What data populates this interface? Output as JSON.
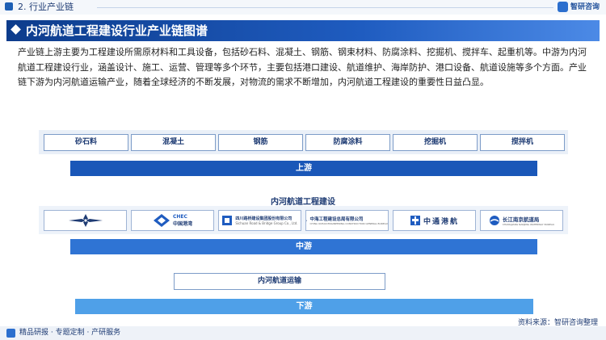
{
  "header": {
    "section_label": "2. 行业产业链",
    "brand": "智研咨询"
  },
  "title": "内河航道工程建设行业产业链图谱",
  "intro": "产业链上游主要为工程建设所需原材料和工具设备，包括砂石料、混凝土、钢筋、钢束材料、防腐涂料、挖掘机、搅拌车、起重机等。中游为内河航道工程建设行业，涵盖设计、施工、运营、管理等多个环节，主要包括港口建设、航道维护、海岸防护、港口设备、航道设施等多个方面。产业链下游为内河航道运输产业，随着全球经济的不断发展，对物流的需求不断增加，内河航道工程建设的重要性日益凸显。",
  "upstream": {
    "items": [
      "砂石料",
      "混凝土",
      "钢筋",
      "防腐涂料",
      "挖掘机",
      "搅拌机"
    ],
    "label": "上游"
  },
  "midstream": {
    "heading": "内河航道工程建设",
    "companies": [
      {
        "name": "",
        "sub": "",
        "icon": "compass-star-logo-icon"
      },
      {
        "name": "中国港湾",
        "sub": "CHEC",
        "icon": "chec-logo-icon"
      },
      {
        "name": "四川路桥建设集团股份有限公司",
        "sub": "Sichuan Road & Bridge Group Co., Ltd.",
        "icon": "srbg-logo-icon"
      },
      {
        "name": "中海工程建设总局有限公司",
        "sub": "CHINA OCEAN ENGINEERING CONSTRUCTION GENERAL BUREAU",
        "icon": "cocgb-logo-icon"
      },
      {
        "name": "中通港航",
        "sub": "",
        "icon": "zhongtong-logo-icon"
      },
      {
        "name": "长江南京航道局",
        "sub": "CHANGJIANG NANJING WATERWAY BUREAU",
        "icon": "cjnj-logo-icon"
      }
    ],
    "label": "中游"
  },
  "downstream": {
    "items": [
      "内河航道运输"
    ],
    "label": "下游"
  },
  "footer": {
    "left": "精品研报 · 专题定制 · 产研服务",
    "source": "资料来源：智研咨询整理"
  },
  "colors": {
    "brand_blue": "#1d5fb5",
    "upstream_bar": "#1a57b8",
    "midstream_bar": "#2f74d4",
    "downstream_bar": "#4fa0e8"
  }
}
